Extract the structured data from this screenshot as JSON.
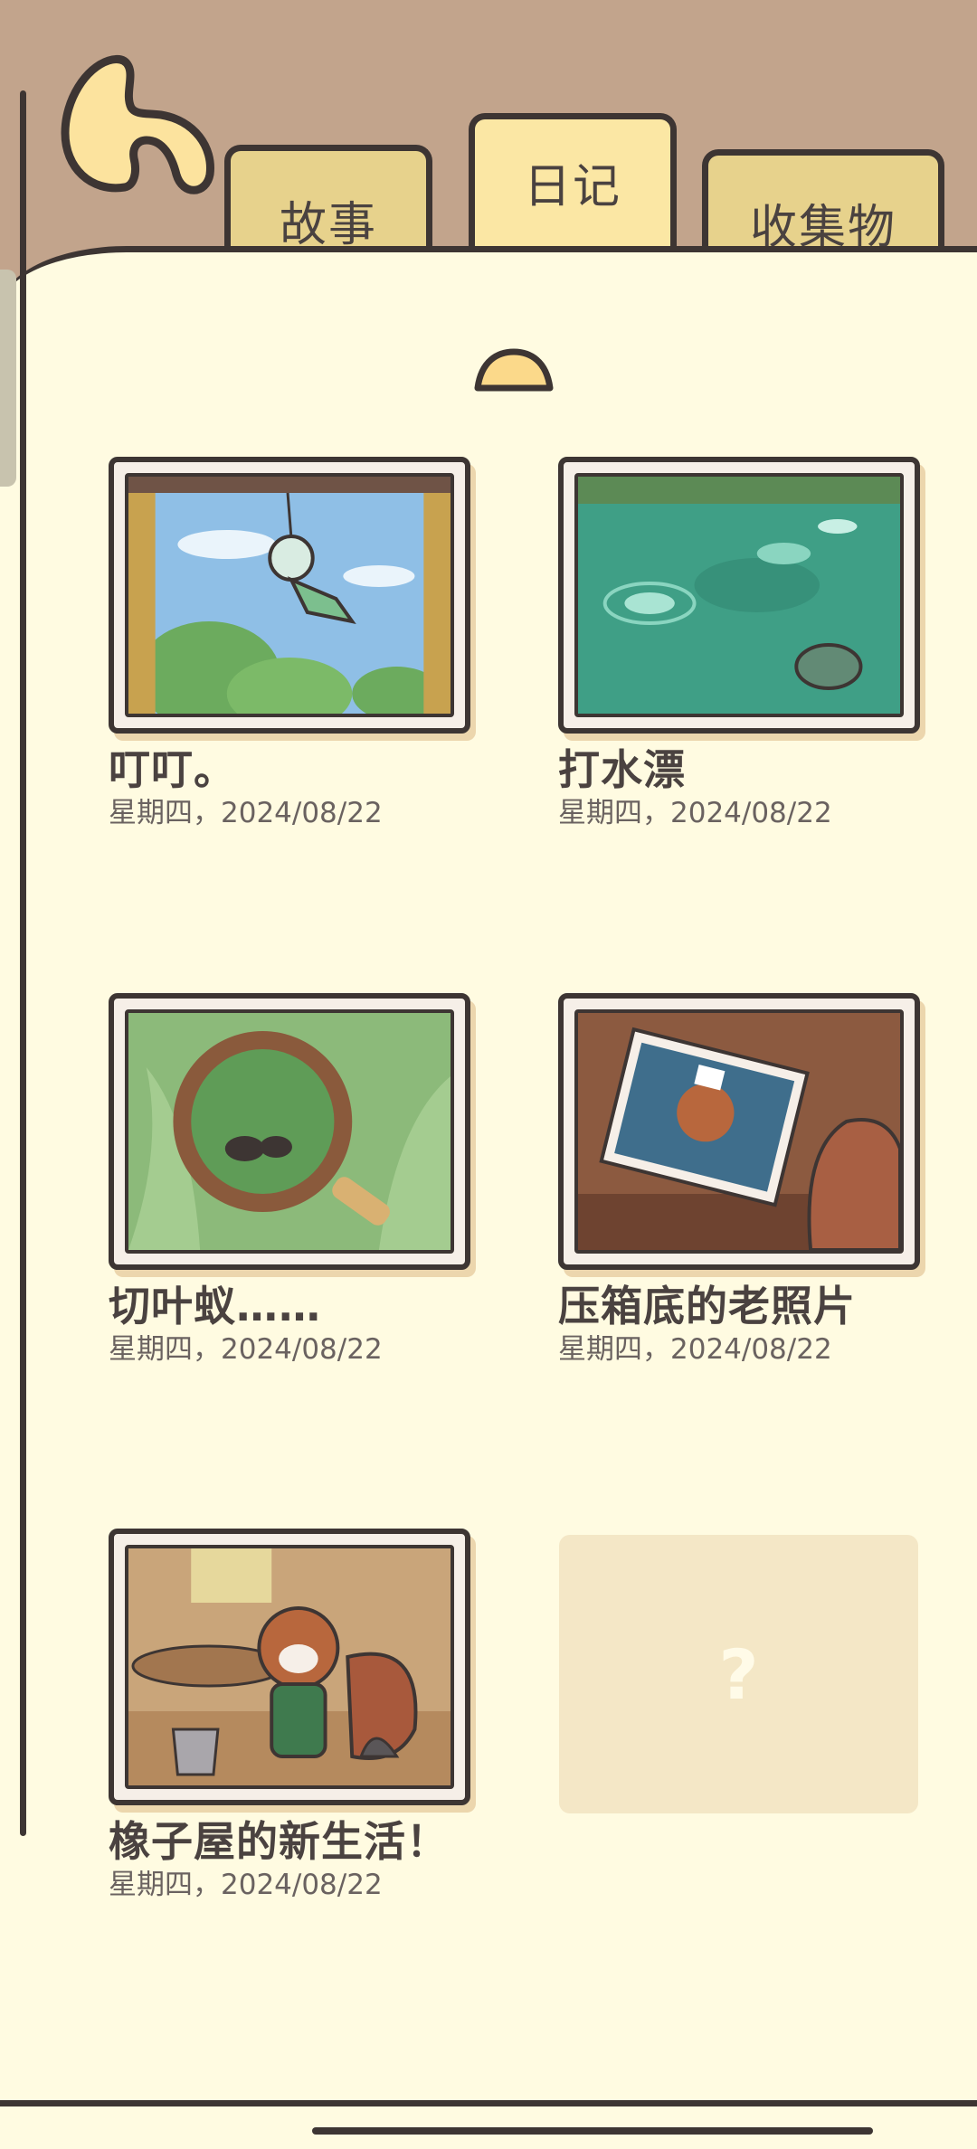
{
  "tabs": {
    "story": "故事",
    "diary": "日记",
    "collection": "收集物"
  },
  "entries": [
    {
      "title": "叮叮。",
      "date": "星期四，2024/08/22",
      "image": "wind-chime"
    },
    {
      "title": "打水漂",
      "date": "星期四，2024/08/22",
      "image": "pond-skipping-stones"
    },
    {
      "title": "切叶蚁……",
      "date": "星期四，2024/08/22",
      "image": "leafcutter-ant-magnifier"
    },
    {
      "title": "压箱底的老照片",
      "date": "星期四，2024/08/22",
      "image": "old-photo-squirrel-chef"
    },
    {
      "title": "橡子屋的新生活！",
      "date": "星期四，2024/08/22",
      "image": "squirrel-cleaning-room"
    }
  ],
  "locked_entry": {
    "symbol": "?"
  },
  "icons": {
    "back": "back-arrow-icon",
    "scroll_up": "scroll-up-icon"
  },
  "colors": {
    "header_bg": "#c2a48c",
    "page_bg": "#fffbe1",
    "tab_active": "#fbe7a4",
    "tab_inactive": "#e7d28c",
    "outline": "#3d3533",
    "text": "#4a4240"
  }
}
